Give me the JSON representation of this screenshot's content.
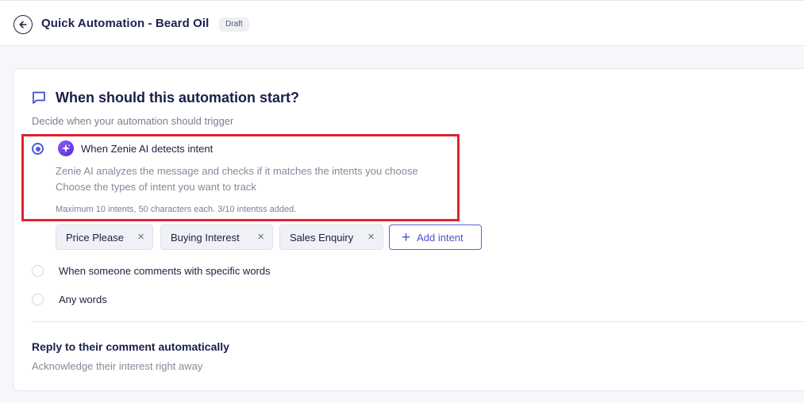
{
  "header": {
    "title": "Quick Automation - Beard Oil",
    "badge": "Draft"
  },
  "trigger": {
    "title": "When should this automation start?",
    "subtitle": "Decide when your automation should trigger",
    "options": [
      {
        "label": "When Zenie AI detects intent",
        "selected": true
      },
      {
        "label": "When someone comments with specific words",
        "selected": false
      },
      {
        "label": "Any words",
        "selected": false
      }
    ],
    "ai_description_1": "Zenie AI analyzes the message and checks if it matches the intents you choose",
    "ai_description_2": "Choose the types of intent you want to track",
    "limit_note": "Maximum 10 intents, 50 characters each. 3/10 intentss added.",
    "intents": [
      "Price Please",
      "Buying Interest",
      "Sales Enquiry"
    ],
    "add_intent_label": "Add intent"
  },
  "reply": {
    "title": "Reply to their comment automatically",
    "subtitle": "Acknowledge their interest right away"
  },
  "icons": {
    "back": "arrow-left-circle-icon",
    "section": "chat-bubble-icon",
    "ai": "sparkle-icon",
    "remove": "close-icon",
    "add": "plus-icon"
  },
  "colors": {
    "accent": "#4f5bd5",
    "highlight": "#e0242c",
    "ai_gradient_start": "#8b5cf6",
    "ai_gradient_end": "#5b2bd9"
  }
}
